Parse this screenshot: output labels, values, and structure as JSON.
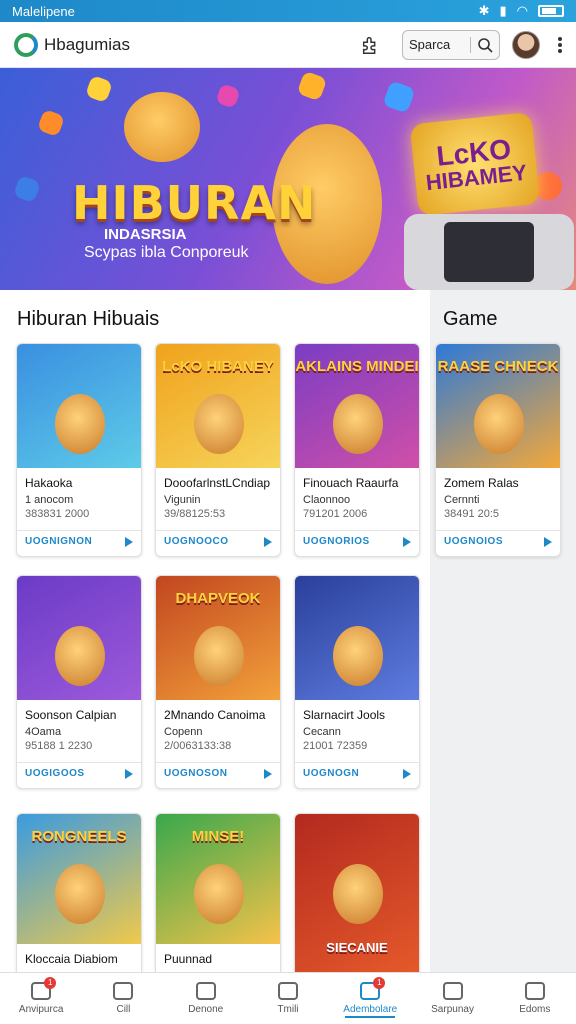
{
  "status_bar": {
    "title": "Malelipene"
  },
  "app_bar": {
    "app_name": "Hbagumias",
    "search_label": "Sparca"
  },
  "hero": {
    "title": "HIBURAN",
    "subtitle_1": "INDASRSIA",
    "subtitle_2": "Scypas ibla Conporeuk",
    "badge_line_1": "LcKO",
    "badge_line_2": "HIBAMEY"
  },
  "sections": {
    "left_title": "Hiburan Hibuais",
    "right_title": "Game"
  },
  "cards": [
    {
      "thumb_text": "",
      "name": "Hakaoka",
      "sub": "1 anocom",
      "meta": "383831 2000",
      "action": "UOGNIGNON",
      "colors": [
        "#3a8fe0",
        "#5ecbe8"
      ]
    },
    {
      "thumb_text": "LcKO HIBANEY",
      "name": "DooofarlnstLCndiap",
      "sub": "Vigunin",
      "meta": "39/88125:53",
      "action": "UOGNOOCO",
      "colors": [
        "#f0a21c",
        "#f6d45a"
      ]
    },
    {
      "thumb_text": "AKLAINS MINDEI",
      "name": "Finouach Raaurfa",
      "sub": "Claonnoo",
      "meta": "791201 2006",
      "action": "UOGNORIOS",
      "colors": [
        "#7b3dc4",
        "#d04fa8"
      ]
    },
    {
      "thumb_text": "RAASE CHNECK",
      "name": "Zomem Ralas",
      "sub": "Cernnti",
      "meta": "38491 20:5",
      "action": "UOGNOIOS",
      "colors": [
        "#2d79d8",
        "#f3a83a"
      ]
    },
    {
      "thumb_text": "",
      "name": "Soonson Calpian",
      "sub": "4Oama",
      "meta": "95188 1 2230",
      "action": "UOGIGOOS",
      "colors": [
        "#6b3bc6",
        "#9d5adb"
      ]
    },
    {
      "thumb_text": "DHAPVEOK",
      "name": "2Mnando Canoima",
      "sub": "Copenn",
      "meta": "2/0063133:38",
      "action": "UOGNOSON",
      "colors": [
        "#c2461f",
        "#f2a13b"
      ]
    },
    {
      "thumb_text": "",
      "name": "Slarnacirt Jools",
      "sub": "Cecann",
      "meta": "21001 72359",
      "action": "UOGNOGN",
      "colors": [
        "#2a3f9a",
        "#5e7de0"
      ]
    },
    {
      "thumb_text": "RONGNEELS",
      "name": "Kloccaia Diabiom",
      "sub": "",
      "meta": "",
      "action": "",
      "colors": [
        "#3a9be0",
        "#f0c94a"
      ]
    },
    {
      "thumb_text": "MINSE!",
      "name": "Puunnad",
      "sub": "",
      "meta": "",
      "action": "",
      "colors": [
        "#38a84c",
        "#f6c24a"
      ]
    },
    {
      "thumb_text": "SIECANIE",
      "name": "",
      "sub": "",
      "meta": "",
      "action": "",
      "colors": [
        "#b3291f",
        "#e55a2a"
      ]
    }
  ],
  "bottom_nav": [
    {
      "label": "Anvipurca",
      "badge": "1"
    },
    {
      "label": "Cill",
      "badge": ""
    },
    {
      "label": "Denone",
      "badge": ""
    },
    {
      "label": "Tmili",
      "badge": ""
    },
    {
      "label": "Adembolare",
      "badge": "1",
      "active": true
    },
    {
      "label": "Sarpunay",
      "badge": ""
    },
    {
      "label": "Edoms",
      "badge": ""
    }
  ]
}
